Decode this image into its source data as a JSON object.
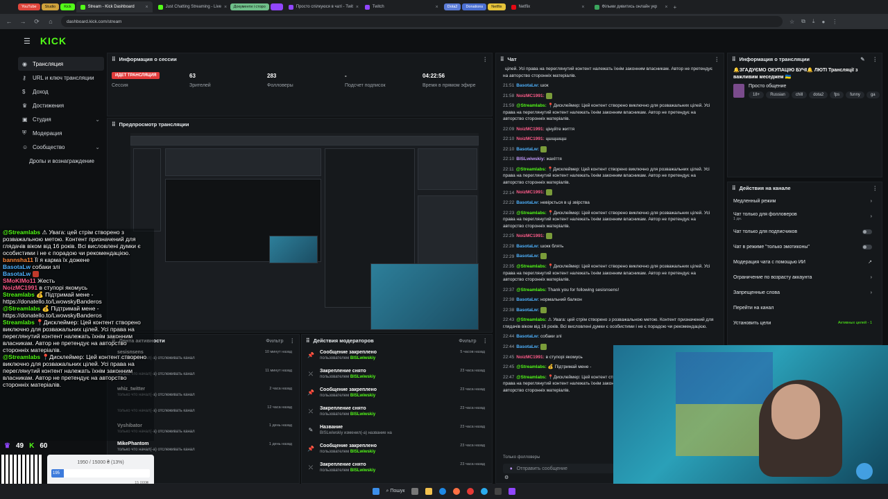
{
  "browser": {
    "tabs": [
      {
        "label": "Stream - Kick Dashboard",
        "active": true
      },
      {
        "label": "Just Chatting Streaming - Live",
        "active": false
      },
      {
        "label": "Просто спілкуюся в чаті - Twit",
        "active": false
      },
      {
        "label": "Twitch",
        "active": false
      },
      {
        "label": "Netflix",
        "active": false
      },
      {
        "label": "Фільми дивитись онлайн укр",
        "active": false
      }
    ],
    "bookmarks": [
      "YouTube",
      "Studio",
      "Kick",
      "Документи і сторо",
      "Dota2",
      "Donations",
      "Netflix"
    ],
    "url": "dashboard.kick.com/stream"
  },
  "logo": "KICK",
  "sidebar": {
    "items": [
      {
        "label": "Трансляция",
        "icon": "broadcast-icon",
        "active": true
      },
      {
        "label": "URL и ключ трансляции",
        "icon": "key-icon"
      },
      {
        "label": "Доход",
        "icon": "dollar-icon"
      },
      {
        "label": "Достижения",
        "icon": "trophy-icon"
      },
      {
        "label": "Студия",
        "icon": "studio-icon",
        "expandable": true
      },
      {
        "label": "Модерация",
        "icon": "shield-icon"
      },
      {
        "label": "Сообщество",
        "icon": "community-icon",
        "expandable": true
      },
      {
        "label": "Дропы и вознаграждение",
        "icon": ""
      }
    ]
  },
  "session": {
    "title": "Информация о сессии",
    "live_badge": "ИДЕТ ТРАНСЛЯЦИЯ",
    "stats": [
      {
        "value": "",
        "label": "Сессия"
      },
      {
        "value": "63",
        "label": "Зрителей"
      },
      {
        "value": "283",
        "label": "Фолловеры"
      },
      {
        "value": "-",
        "label": "Подсчет подписок"
      },
      {
        "value": "04:22:56",
        "label": "Время в прямом эфире"
      }
    ]
  },
  "preview": {
    "title": "Предпросмотр трансляции"
  },
  "activity": {
    "title": "Лента активности",
    "filter": "Фильтр",
    "rows": [
      {
        "name": "sesisnsens",
        "desc": "только что начал(-а) отслеживать канал",
        "time": "10 минут назад"
      },
      {
        "name": "",
        "desc": "только что начал(-а) отслеживать канал",
        "time": "11 минут назад"
      },
      {
        "name": "whiz_twitter",
        "desc": "только что начал(-а) отслеживать канал",
        "time": "2 часа назад"
      },
      {
        "name": "",
        "desc": "только что начал(-а) отслеживать канал",
        "time": "12 часа назад"
      },
      {
        "name": "Vyshibator",
        "desc": "только что начал(-а) отслеживать канал",
        "time": "1 день назад"
      },
      {
        "name": "MikePhantom",
        "desc": "только что начал(-а) отслеживать канал",
        "time": "1 день назад"
      }
    ]
  },
  "modactions": {
    "title": "Действия модераторов",
    "filter": "Фильтр",
    "rows": [
      {
        "icon": "pin-icon",
        "title": "Сообщение закреплено",
        "by": "пользователем",
        "user": "BISLwiwskiy",
        "time": "5 часов назад"
      },
      {
        "icon": "unpin-icon",
        "title": "Закрепление снято",
        "by": "пользователем",
        "user": "BISLwiwskiy",
        "time": "23 часа назад"
      },
      {
        "icon": "pin-icon",
        "title": "Сообщение закреплено",
        "by": "пользователем",
        "user": "BISLwiwskiy",
        "time": "23 часа назад"
      },
      {
        "icon": "unpin-icon",
        "title": "Закрепление снято",
        "by": "пользователем",
        "user": "BISLwiwskiy",
        "time": "23 часа назад"
      },
      {
        "icon": "rename-icon",
        "title": "Название",
        "by": "BISLwiwskiy изменил(-а) название на",
        "user": "",
        "time": "23 часа назад"
      },
      {
        "icon": "pin-icon",
        "title": "Сообщение закреплено",
        "by": "пользователем",
        "user": "BISLwiwskiy",
        "time": "23 часа назад"
      },
      {
        "icon": "unpin-icon",
        "title": "Закрепление снято",
        "by": "пользователем",
        "user": "BISLwiwskiy",
        "time": "23 часа назад"
      }
    ]
  },
  "chat": {
    "title": "Чат",
    "send_placeholder": "Отправить сообщение",
    "followers_only": "Только фолловеры",
    "messages": [
      {
        "ts": "",
        "user": "",
        "cls": "",
        "text": "цілей. Усі права на переглянутий контент належать їхнім законним власникам. Автор не претендує на авторство сторонніх матеріалів."
      },
      {
        "ts": "21:51",
        "user": "BasotaLw:",
        "cls": "u-lw",
        "text": "шок"
      },
      {
        "ts": "21:58",
        "user": "NoizMC1991:",
        "cls": "u-nz",
        "text": ""
      },
      {
        "ts": "21:59",
        "user": "@Streamlabs:",
        "cls": "u-sl",
        "text": "📍Дисклеймер: Цей контент створено виключно для розважальних цілей. Усі права на переглянутий контент належать їхнім законним власникам. Автор не претендує на авторство сторонніх матеріалів."
      },
      {
        "ts": "22:09",
        "user": "NoizMC1991:",
        "cls": "u-nz",
        "text": "цінуйте життя"
      },
      {
        "ts": "22:10",
        "user": "NoizMC1991:",
        "cls": "u-nz",
        "text": "цшщшщш"
      },
      {
        "ts": "22:10",
        "user": "BasotaLw:",
        "cls": "u-lw",
        "text": ""
      },
      {
        "ts": "22:10",
        "user": "BISLwiwskiy:",
        "cls": "u-bw",
        "text": "жахіття"
      },
      {
        "ts": "22:11",
        "user": "@Streamlabs:",
        "cls": "u-sl",
        "text": "📍Дисклеймер: Цей контент створено виключно для розважальних цілей. Усі права на переглянутий контент належать їхнім законним власникам. Автор не претендує на авторство сторонніх матеріалів."
      },
      {
        "ts": "22:14",
        "user": "NoizMC1991:",
        "cls": "u-nz",
        "text": ""
      },
      {
        "ts": "22:22",
        "user": "BasotaLw:",
        "cls": "u-lw",
        "text": "невірється в ці звірства"
      },
      {
        "ts": "22:23",
        "user": "@Streamlabs:",
        "cls": "u-sl",
        "text": "📍Дисклеймер: Цей контент створено виключно для розважальних цілей. Усі права на переглянутий контент належать їхнім законним власникам. Автор не претендує на авторство сторонніх матеріалів."
      },
      {
        "ts": "22:25",
        "user": "NoizMC1991:",
        "cls": "u-nz",
        "text": ""
      },
      {
        "ts": "22:28",
        "user": "BasotaLw:",
        "cls": "u-lw",
        "text": "шокк блять"
      },
      {
        "ts": "22:29",
        "user": "BasotaLw:",
        "cls": "u-lw",
        "text": ""
      },
      {
        "ts": "22:35",
        "user": "@Streamlabs:",
        "cls": "u-sl",
        "text": "📍Дисклеймер: Цей контент створено виключно для розважальних цілей. Усі права на переглянутий контент належать їхнім законним власникам. Автор не претендує на авторство сторонніх матеріалів."
      },
      {
        "ts": "22:37",
        "user": "@Streamlabs:",
        "cls": "u-sl",
        "text": "Thank you for following sesisnsens!"
      },
      {
        "ts": "22:38",
        "user": "BasotaLw:",
        "cls": "u-lw",
        "text": "нормальний балкон"
      },
      {
        "ts": "22:38",
        "user": "BasotaLw:",
        "cls": "u-lw",
        "text": ""
      },
      {
        "ts": "22:43",
        "user": "@Streamlabs:",
        "cls": "u-sl",
        "text": "⚠ Увага: цей стрім створено з розважальною метою. Контент призначений для глядачів віком від 16 років. Всі висловлені думки є особистими і не є порадою чи рекомендацією."
      },
      {
        "ts": "22:44",
        "user": "BasotaLw:",
        "cls": "u-lw",
        "text": "собаки злі"
      },
      {
        "ts": "22:44",
        "user": "BasotaLw:",
        "cls": "u-lw",
        "text": ""
      },
      {
        "ts": "22:45",
        "user": "NoizMC1991:",
        "cls": "u-nz",
        "text": "в ступорі якомусь"
      },
      {
        "ts": "22:45",
        "user": "@Streamlabs:",
        "cls": "u-sl",
        "text": "💰 Підтримай мене -"
      },
      {
        "ts": "22:47",
        "user": "@Streamlabs:",
        "cls": "u-sl",
        "text": "📍Дисклеймер: Цей контент створено виключно для розважальних цілей. Усі права на переглянутий контент належать їхнім законним власникам. Автор не претендує на авторство сторонніх матеріалів."
      }
    ]
  },
  "stream_info": {
    "title": "Информация о трансляции",
    "stream_title": "🔔ЗГАДУЄМО ОКУПАЦІЮ БУЧІ🔔 ЛЮТІ Трансляції з важливим меседжем 🇺🇦",
    "category": "Просто общение",
    "tags": [
      "18+",
      "Russian",
      "chill",
      "dota2",
      "fps",
      "funny",
      "ga"
    ]
  },
  "channel_actions": {
    "title": "Действия на канале",
    "items": [
      {
        "label": "Медленный режим",
        "control": "chevron"
      },
      {
        "label": "Чат только для фолловеров",
        "sub": "1 дн.",
        "control": "chevron"
      },
      {
        "label": "Чат только для подписчиков",
        "control": "toggle"
      },
      {
        "label": "Чат в режиме \"только эмотиконы\"",
        "control": "toggle"
      },
      {
        "label": "Модерация чата с помощью ИИ",
        "control": "external"
      },
      {
        "label": "Ограничение по возрасту аккаунта",
        "control": "chevron"
      },
      {
        "label": "Запрещенные слова",
        "control": "chevron"
      },
      {
        "label": "Перейти на канал",
        "control": "none"
      },
      {
        "label": "Установить цели",
        "control": "goal"
      }
    ],
    "goals_label": "Активных целей - 1"
  },
  "overlay": {
    "chat": [
      {
        "name": "@Streamlabs",
        "cls": "n2",
        "text": "⚠ Увага: цей стрім створено з розважальною метою. Контент призначений для глядачів віком від 16 років. Всі висловлені думки є особистими і не є порадою чи рекомендацією."
      },
      {
        "name": "bannsha11",
        "cls": "n4",
        "text": "Її я карма їх доженe"
      },
      {
        "name": "BasotaLw",
        "cls": "n1",
        "text": "собаки злі"
      },
      {
        "name": "BasotaLw",
        "cls": "n1",
        "text": ""
      },
      {
        "name": "SMoKIMo11",
        "cls": "n3",
        "text": "Жесть"
      },
      {
        "name": "NoizMC1991",
        "cls": "n3",
        "text": "в ступорі якомусь"
      },
      {
        "name": "Streamlabs",
        "cls": "n2",
        "text": "💰 Підтримай мене - https://donatello.to/LwowskyBanderos"
      },
      {
        "name": "@Streamlabs",
        "cls": "n2",
        "text": "💰 Підтримай мене - https://donatello.to/LwowskyBanderos"
      },
      {
        "name": "Streamlabs",
        "cls": "n2",
        "text": "📍Дисклеймер: Цей контент створено виключно для розважальних цілей. Усі права на переглянутий контент належать їхнім законним власникам. Автор не претендує на авторство сторонніх матеріалів."
      },
      {
        "name": "@Streamlabs",
        "cls": "n2",
        "text": "📍Дисклеймер: Цей контент створено виключно для розважальних цілей. Усі права на переглянутий контент належать їхнім законним власникам. Автор не претендує на авторство сторонніх матеріалів."
      }
    ],
    "twitch_viewers": "49",
    "kick_viewers": "60",
    "goal_text": "1950 / 15000 ₴ (13%)",
    "goal_progress": 0.13,
    "goal_min": "195",
    "goal_max": "15 000₴"
  },
  "taskbar": {
    "search": "Пошук"
  }
}
